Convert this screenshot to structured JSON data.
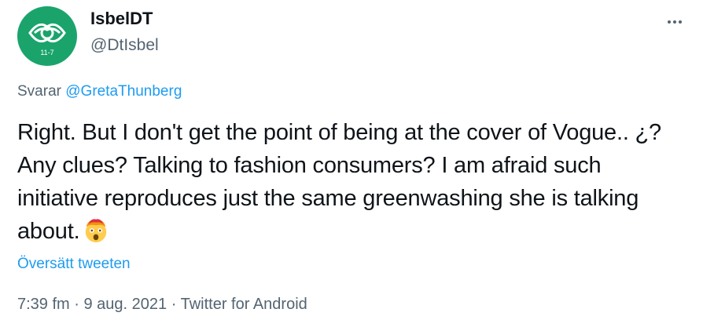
{
  "user": {
    "display_name": "IsbelDT",
    "handle": "@DtIsbel",
    "avatar_text": "11-7",
    "avatar_color": "#1aa46b"
  },
  "more_icon": "more-horizontal-icon",
  "reply": {
    "prefix": "Svarar",
    "mention": "@GretaThunberg"
  },
  "tweet": {
    "text": "Right. But I don't get the point of being at the cover of Vogue.. ¿? Any clues? Talking to fashion consumers? I am afraid such initiative reproduces just the same greenwashing she is talking about.",
    "emoji": "exploding-head-emoji"
  },
  "translate_label": "Översätt tweeten",
  "meta": {
    "time": "7:39 fm",
    "separator": "·",
    "date": "9 aug. 2021",
    "source": "Twitter for Android"
  },
  "colors": {
    "link": "#1d9bf0",
    "secondary": "#536471",
    "text": "#0f1419"
  }
}
